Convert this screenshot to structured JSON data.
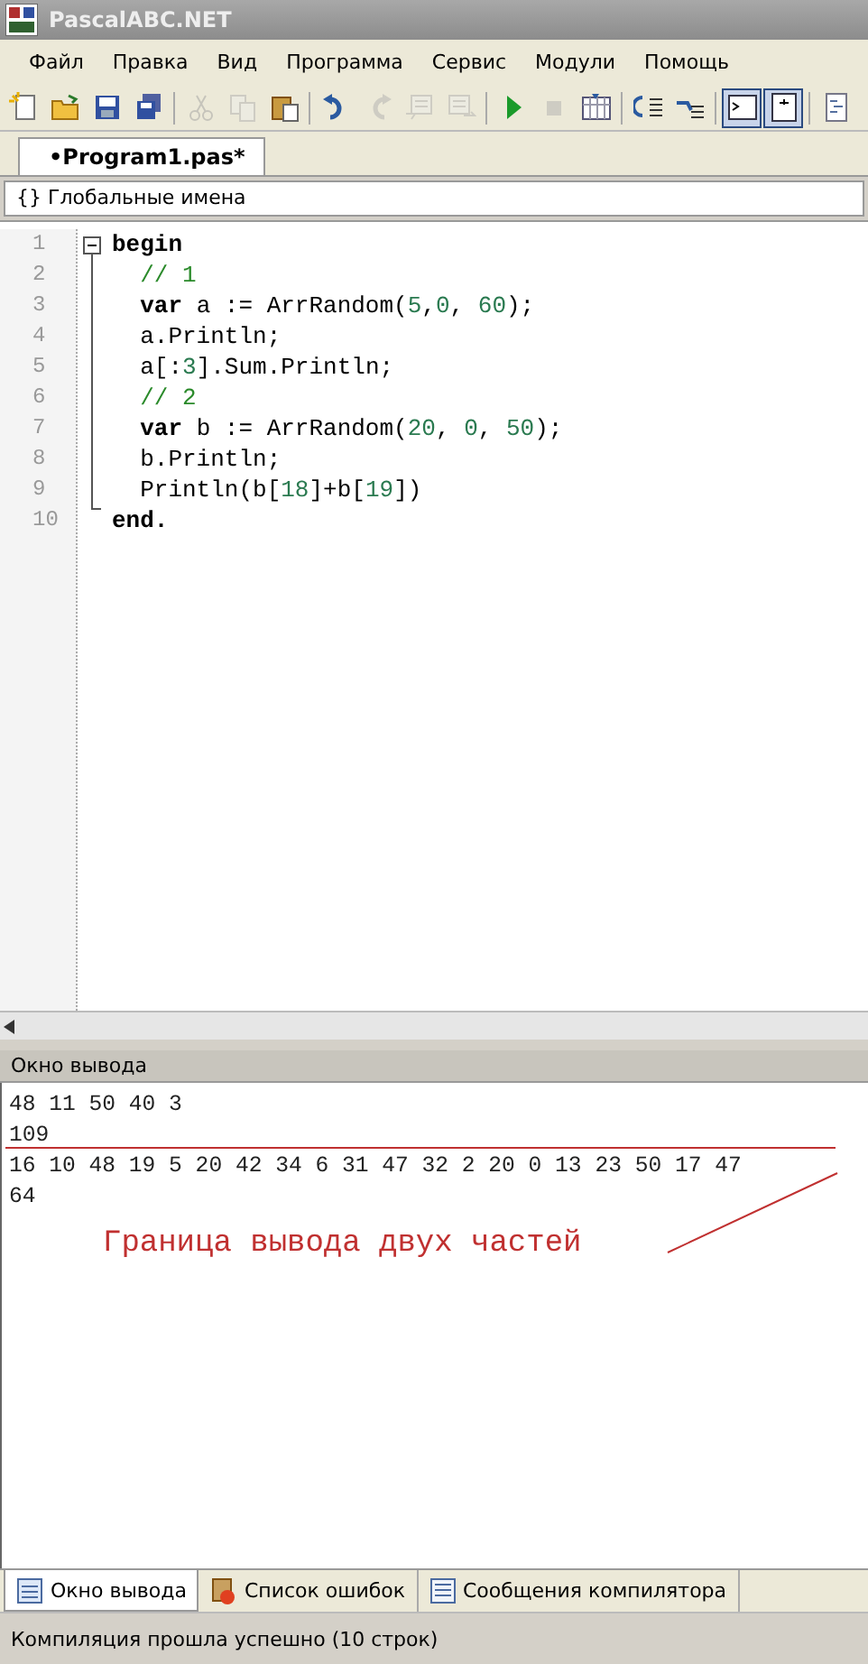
{
  "window": {
    "title": "PascalABC.NET"
  },
  "menu": [
    "Файл",
    "Правка",
    "Вид",
    "Программа",
    "Сервис",
    "Модули",
    "Помощь"
  ],
  "toolbar": [
    {
      "pressed": false,
      "disabled": false
    },
    {
      "pressed": false,
      "disabled": false
    },
    {
      "pressed": false,
      "disabled": false
    },
    {
      "pressed": false,
      "disabled": false
    },
    {
      "pressed": false,
      "disabled": true
    },
    {
      "pressed": false,
      "disabled": true
    },
    {
      "pressed": false,
      "disabled": false
    },
    {
      "pressed": false,
      "disabled": false
    },
    {
      "pressed": false,
      "disabled": true
    },
    {
      "pressed": false,
      "disabled": true
    },
    {
      "pressed": false,
      "disabled": true
    },
    {
      "pressed": false,
      "disabled": false
    },
    {
      "pressed": false,
      "disabled": true
    },
    {
      "pressed": false,
      "disabled": false
    },
    {
      "pressed": false,
      "disabled": false
    },
    {
      "pressed": false,
      "disabled": false
    },
    {
      "pressed": true,
      "disabled": false
    },
    {
      "pressed": true,
      "disabled": false
    },
    {
      "pressed": false,
      "disabled": false
    }
  ],
  "editor_tabs": [
    {
      "label": "•Program1.pas*",
      "selected": true
    }
  ],
  "scope_box": {
    "value": "{} Глобальные имена"
  },
  "code": [
    {
      "number": "1",
      "tokens": [
        {
          "kind": "keyword",
          "text": "begin"
        }
      ]
    },
    {
      "number": "2",
      "tokens": [
        {
          "kind": "comment",
          "text": "  // 1"
        }
      ]
    },
    {
      "number": "3",
      "tokens": [
        {
          "kind": "keyword",
          "text": "  var"
        },
        {
          "kind": "plain",
          "text": " a := ArrRandom("
        },
        {
          "kind": "number",
          "text": "5"
        },
        {
          "kind": "plain",
          "text": ","
        },
        {
          "kind": "number",
          "text": "0"
        },
        {
          "kind": "plain",
          "text": ", "
        },
        {
          "kind": "number",
          "text": "60"
        },
        {
          "kind": "plain",
          "text": ");"
        }
      ]
    },
    {
      "number": "4",
      "tokens": [
        {
          "kind": "plain",
          "text": "  a.Println;"
        }
      ]
    },
    {
      "number": "5",
      "tokens": [
        {
          "kind": "plain",
          "text": "  a[:"
        },
        {
          "kind": "number",
          "text": "3"
        },
        {
          "kind": "plain",
          "text": "].Sum.Println;"
        }
      ]
    },
    {
      "number": "6",
      "tokens": [
        {
          "kind": "comment",
          "text": "  // 2"
        }
      ]
    },
    {
      "number": "7",
      "tokens": [
        {
          "kind": "keyword",
          "text": "  var"
        },
        {
          "kind": "plain",
          "text": " b := ArrRandom("
        },
        {
          "kind": "number",
          "text": "20"
        },
        {
          "kind": "plain",
          "text": ", "
        },
        {
          "kind": "number",
          "text": "0"
        },
        {
          "kind": "plain",
          "text": ", "
        },
        {
          "kind": "number",
          "text": "50"
        },
        {
          "kind": "plain",
          "text": ");"
        }
      ]
    },
    {
      "number": "8",
      "tokens": [
        {
          "kind": "plain",
          "text": "  b.Println;"
        }
      ]
    },
    {
      "number": "9",
      "tokens": [
        {
          "kind": "plain",
          "text": "  Println(b["
        },
        {
          "kind": "number",
          "text": "18"
        },
        {
          "kind": "plain",
          "text": "]+b["
        },
        {
          "kind": "number",
          "text": "19"
        },
        {
          "kind": "plain",
          "text": "])"
        }
      ]
    },
    {
      "number": "10",
      "tokens": [
        {
          "kind": "keyword",
          "text": "end."
        }
      ]
    }
  ],
  "output_panel": {
    "title": "Окно вывода",
    "lines": [
      "48 11 50 40 3",
      "109",
      "16 10 48 19 5 20 42 34 6 31 47 32 2 20 0 13 23 50 17 47",
      "64"
    ],
    "annotation": "Граница вывода двух частей"
  },
  "bottom_tabs": [
    {
      "label": "Окно вывода",
      "selected": true
    },
    {
      "label": "Список ошибок",
      "selected": false
    },
    {
      "label": "Сообщения компилятора",
      "selected": false
    }
  ],
  "status_bar": "Компиляция прошла успешно (10 строк)"
}
